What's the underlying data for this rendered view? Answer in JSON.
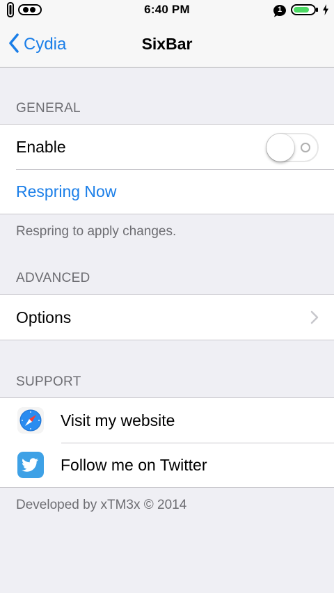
{
  "status_bar": {
    "time": "6:40 PM",
    "notification_count": "1",
    "icons": [
      "phone-outline-icon",
      "signal-dots-icon",
      "notification-bubble-icon",
      "battery-icon",
      "charging-bolt-icon"
    ]
  },
  "nav": {
    "back_label": "Cydia",
    "title": "SixBar"
  },
  "general": {
    "header": "GENERAL",
    "enable_label": "Enable",
    "enable_state": "off",
    "respring_label": "Respring Now",
    "footer": "Respring to apply changes."
  },
  "advanced": {
    "header": "ADVANCED",
    "options_label": "Options"
  },
  "support": {
    "header": "SUPPORT",
    "website_label": "Visit my website",
    "twitter_label": "Follow me on Twitter",
    "footer": "Developed by xTM3x © 2014"
  },
  "colors": {
    "accent": "#1a7ee8",
    "background": "#efeff4",
    "header_text": "#6d6d72",
    "separator": "#c8c7cc",
    "battery_fill": "#4cd964",
    "safari_blue": "#2a8cf0",
    "twitter_blue": "#3ea1e6"
  }
}
